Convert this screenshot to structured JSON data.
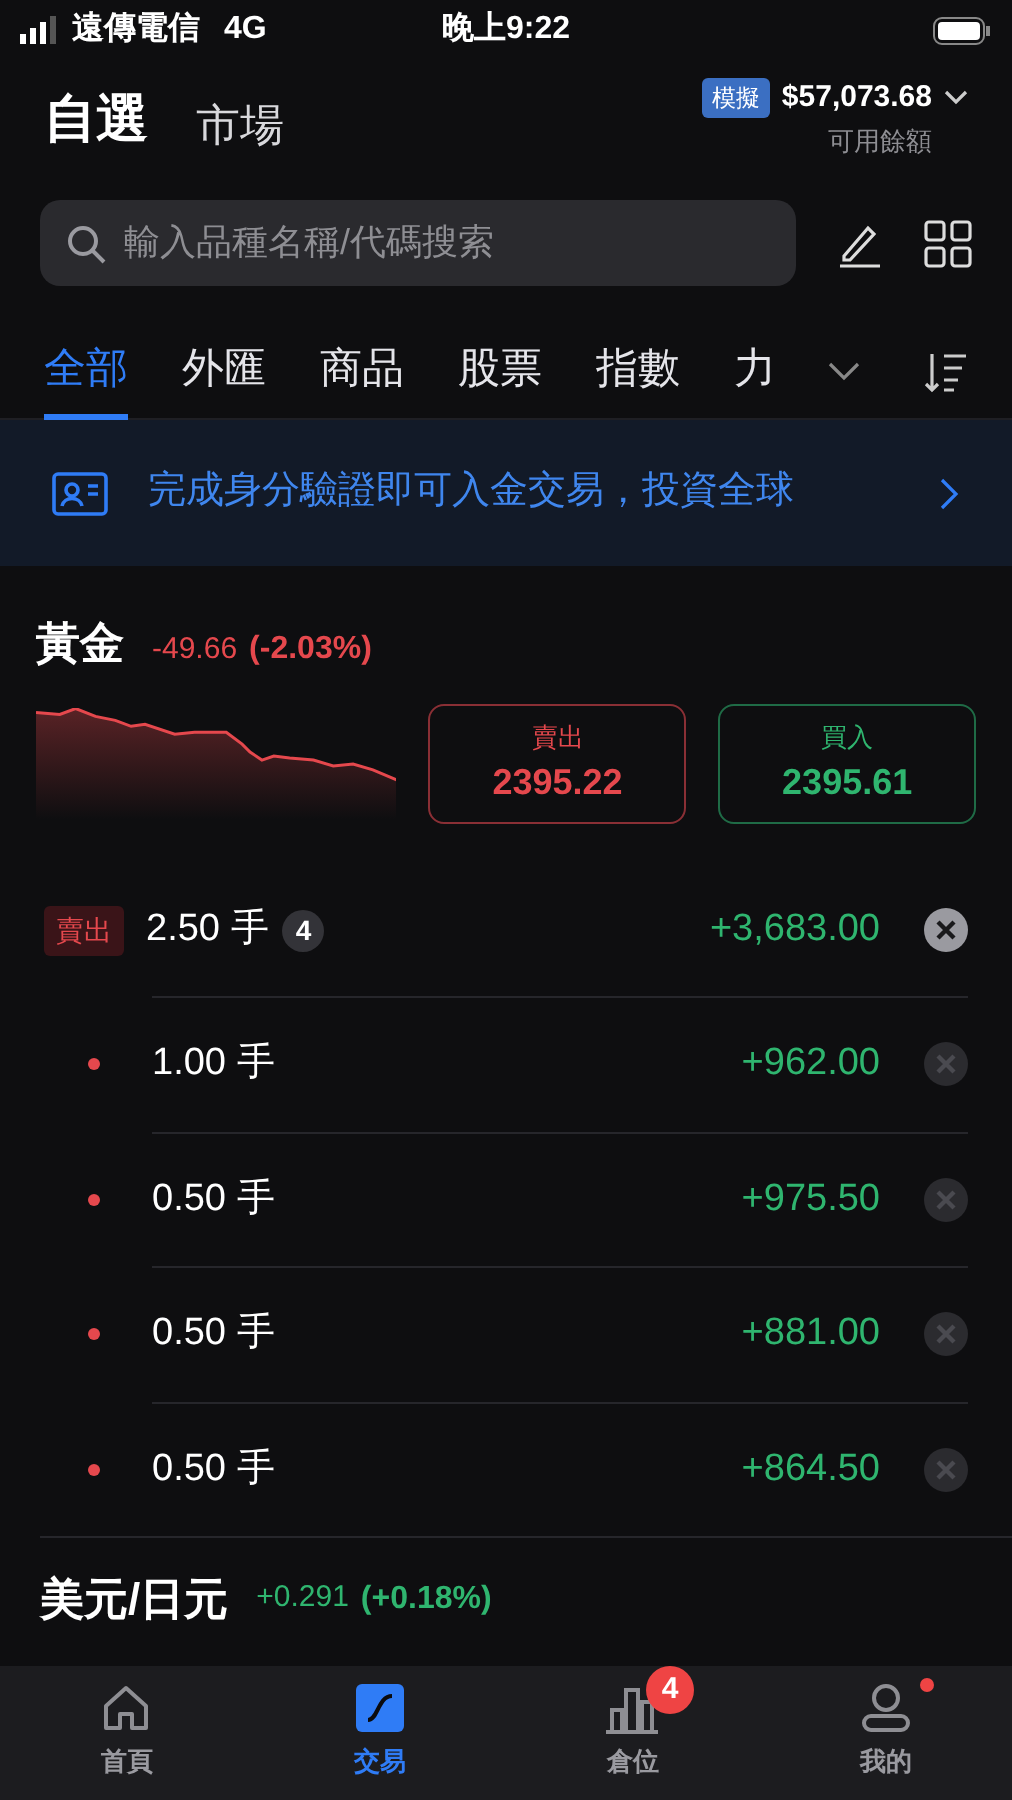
{
  "status_bar": {
    "carrier": "遠傳電信",
    "network": "4G",
    "time": "晚上9:22"
  },
  "header": {
    "views": [
      {
        "label": "自選",
        "selected": true
      },
      {
        "label": "市場",
        "selected": false
      }
    ],
    "account": {
      "badge": "模擬",
      "balance": "$57,073.68",
      "caption": "可用餘額"
    }
  },
  "search": {
    "placeholder": "輸入品種名稱/代碼搜索"
  },
  "categories": [
    {
      "label": "全部",
      "selected": true
    },
    {
      "label": "外匯",
      "selected": false
    },
    {
      "label": "商品",
      "selected": false
    },
    {
      "label": "股票",
      "selected": false
    },
    {
      "label": "指數",
      "selected": false
    },
    {
      "label": "力",
      "selected": false
    }
  ],
  "banner": {
    "text": "完成身分驗證即可入金交易，投資全球"
  },
  "instruments": [
    {
      "name": "黃金",
      "change": "-49.66",
      "percent": "(-2.03%)",
      "kind": "down",
      "sell": {
        "label": "賣出",
        "price": "2395.22"
      },
      "buy": {
        "label": "買入",
        "price": "2395.61"
      },
      "position": {
        "side": "賣出",
        "lots": "2.50 手",
        "count": "4",
        "pnl": "+3,683.00",
        "children": [
          {
            "lots": "1.00 手",
            "pnl": "+962.00"
          },
          {
            "lots": "0.50 手",
            "pnl": "+975.50"
          },
          {
            "lots": "0.50 手",
            "pnl": "+881.00"
          },
          {
            "lots": "0.50 手",
            "pnl": "+864.50"
          }
        ]
      }
    },
    {
      "name": "美元/日元",
      "change": "+0.291",
      "percent": "(+0.18%)",
      "kind": "up"
    }
  ],
  "bottom_nav": [
    {
      "label": "首頁",
      "kind": "home",
      "selected": false
    },
    {
      "label": "交易",
      "kind": "trade",
      "selected": true
    },
    {
      "label": "倉位",
      "kind": "chart",
      "selected": false,
      "badge": "4"
    },
    {
      "label": "我的",
      "kind": "user",
      "selected": false,
      "dot": true
    }
  ]
}
